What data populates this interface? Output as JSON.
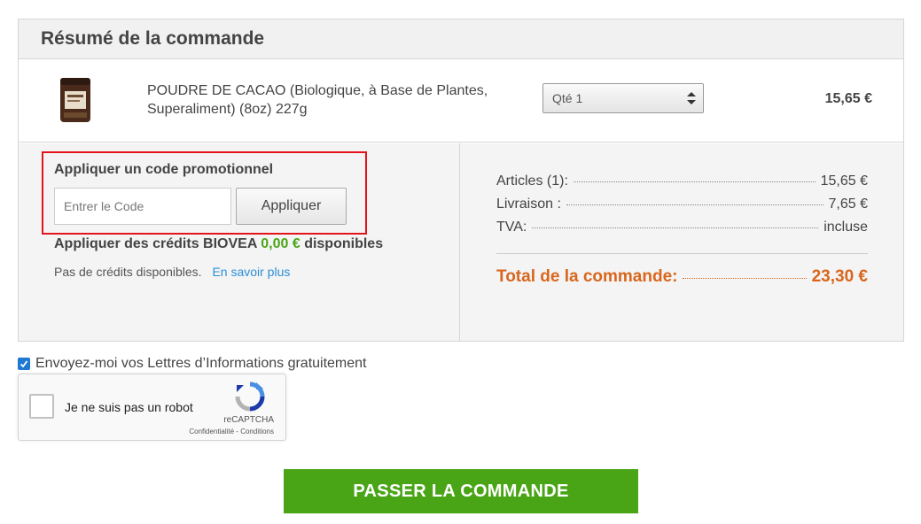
{
  "summary": {
    "title": "Résumé de la commande"
  },
  "item": {
    "name": "POUDRE DE CACAO (Biologique, à Base de Plantes, Superaliment) (8oz) 227g",
    "qty_label": "Qté 1",
    "price": "15,65 €"
  },
  "promo": {
    "title": "Appliquer un code promotionnel",
    "placeholder": "Entrer le Code",
    "apply_label": "Appliquer"
  },
  "credits": {
    "prefix": "Appliquer des crédits BIOVEA",
    "amount": "0,00 €",
    "suffix": "disponibles",
    "none_text": "Pas de crédits disponibles.",
    "learn_more": "En savoir plus"
  },
  "totals": {
    "articles_label": "Articles (1):",
    "articles_value": "15,65 €",
    "shipping_label": "Livraison :",
    "shipping_value": "7,65 €",
    "vat_label": "TVA:",
    "vat_value": "incluse",
    "total_label": "Total de la commande:",
    "total_value": "23,30 €"
  },
  "newsletter": {
    "label": "Envoyez-moi vos Lettres d’Informations gratuitement",
    "checked": true
  },
  "captcha": {
    "label": "Je ne suis pas un robot",
    "brand": "reCAPTCHA",
    "privacy": "Confidentialité",
    "separator": "-",
    "terms": "Conditions"
  },
  "checkout": {
    "button_label": "PASSER LA COMMANDE"
  },
  "colors": {
    "accent_green": "#4aa516",
    "total_orange": "#d9661c",
    "link_blue": "#2b8fd6",
    "highlight_red": "#e3141c"
  }
}
